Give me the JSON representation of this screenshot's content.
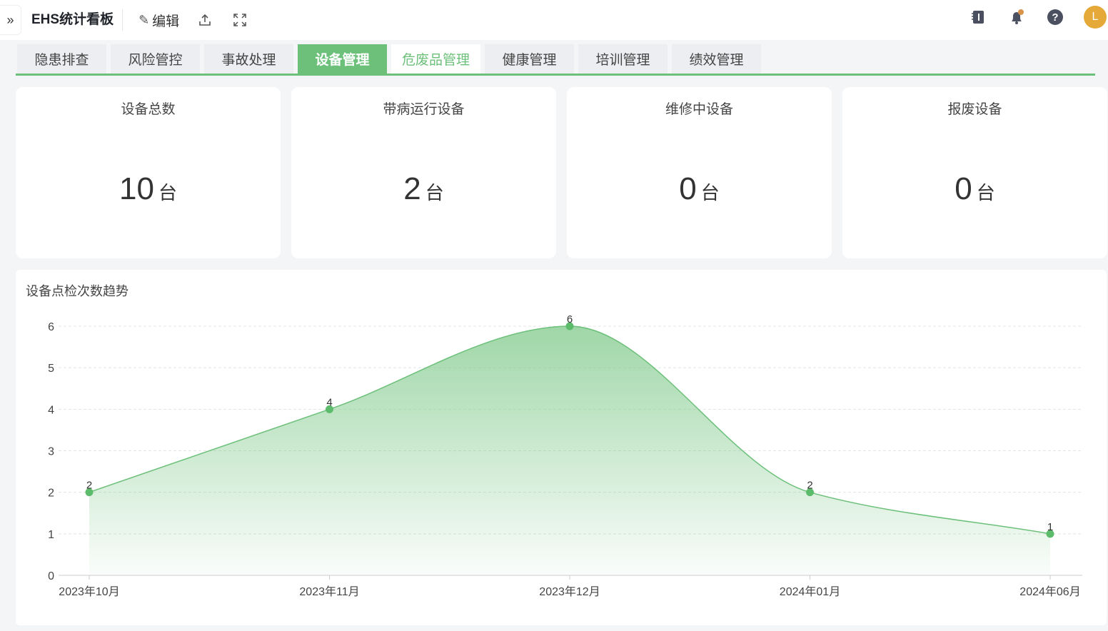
{
  "header": {
    "title": "EHS统计看板",
    "edit_label": "编辑",
    "avatar_letter": "L"
  },
  "tabs": [
    {
      "label": "隐患排查"
    },
    {
      "label": "风险管控"
    },
    {
      "label": "事故处理"
    },
    {
      "label": "设备管理",
      "active": true
    },
    {
      "label": "危废品管理"
    },
    {
      "label": "健康管理"
    },
    {
      "label": "培训管理"
    },
    {
      "label": "绩效管理"
    }
  ],
  "cards": [
    {
      "label": "设备总数",
      "value": "10",
      "unit": "台"
    },
    {
      "label": "带病运行设备",
      "value": "2",
      "unit": "台"
    },
    {
      "label": "维修中设备",
      "value": "0",
      "unit": "台"
    },
    {
      "label": "报废设备",
      "value": "0",
      "unit": "台"
    }
  ],
  "colors": {
    "accent": "#6cc07a",
    "avatar": "#e5a93a"
  },
  "chart_data": {
    "type": "area",
    "title": "设备点检次数趋势",
    "categories": [
      "2023年10月",
      "2023年11月",
      "2023年12月",
      "2024年01月",
      "2024年06月"
    ],
    "values": [
      2,
      4,
      6,
      2,
      1
    ],
    "ylim": [
      0,
      6
    ],
    "yticks": [
      "0",
      "1",
      "2",
      "3",
      "4",
      "5",
      "6"
    ],
    "grid": true,
    "smooth": true
  }
}
